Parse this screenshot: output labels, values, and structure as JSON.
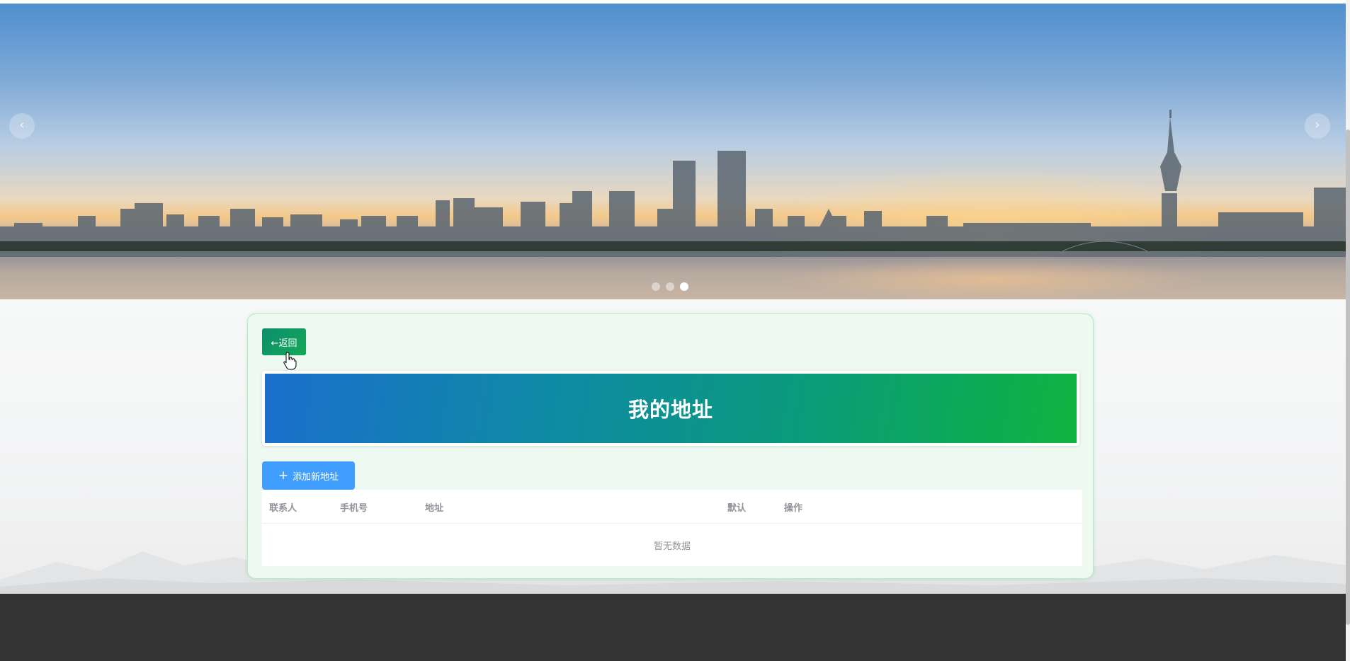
{
  "carousel": {
    "prev_icon": "‹",
    "next_icon": "›",
    "slide_count": 3,
    "active_slide": 3
  },
  "address_page": {
    "back_label": "←返回",
    "title": "我的地址",
    "add_button_label": "添加新地址",
    "add_icon": "plus-icon",
    "table": {
      "columns": [
        "联系人",
        "手机号",
        "地址",
        "默认",
        "操作"
      ],
      "rows": [],
      "empty_text": "暂无数据"
    }
  },
  "colors": {
    "back_button": "#0d8d6e",
    "add_button": "#409eff",
    "title_gradient_start": "#1a6fcc",
    "title_gradient_end": "#10b33f",
    "card_background": "#eefaf1",
    "footer": "#333333"
  }
}
